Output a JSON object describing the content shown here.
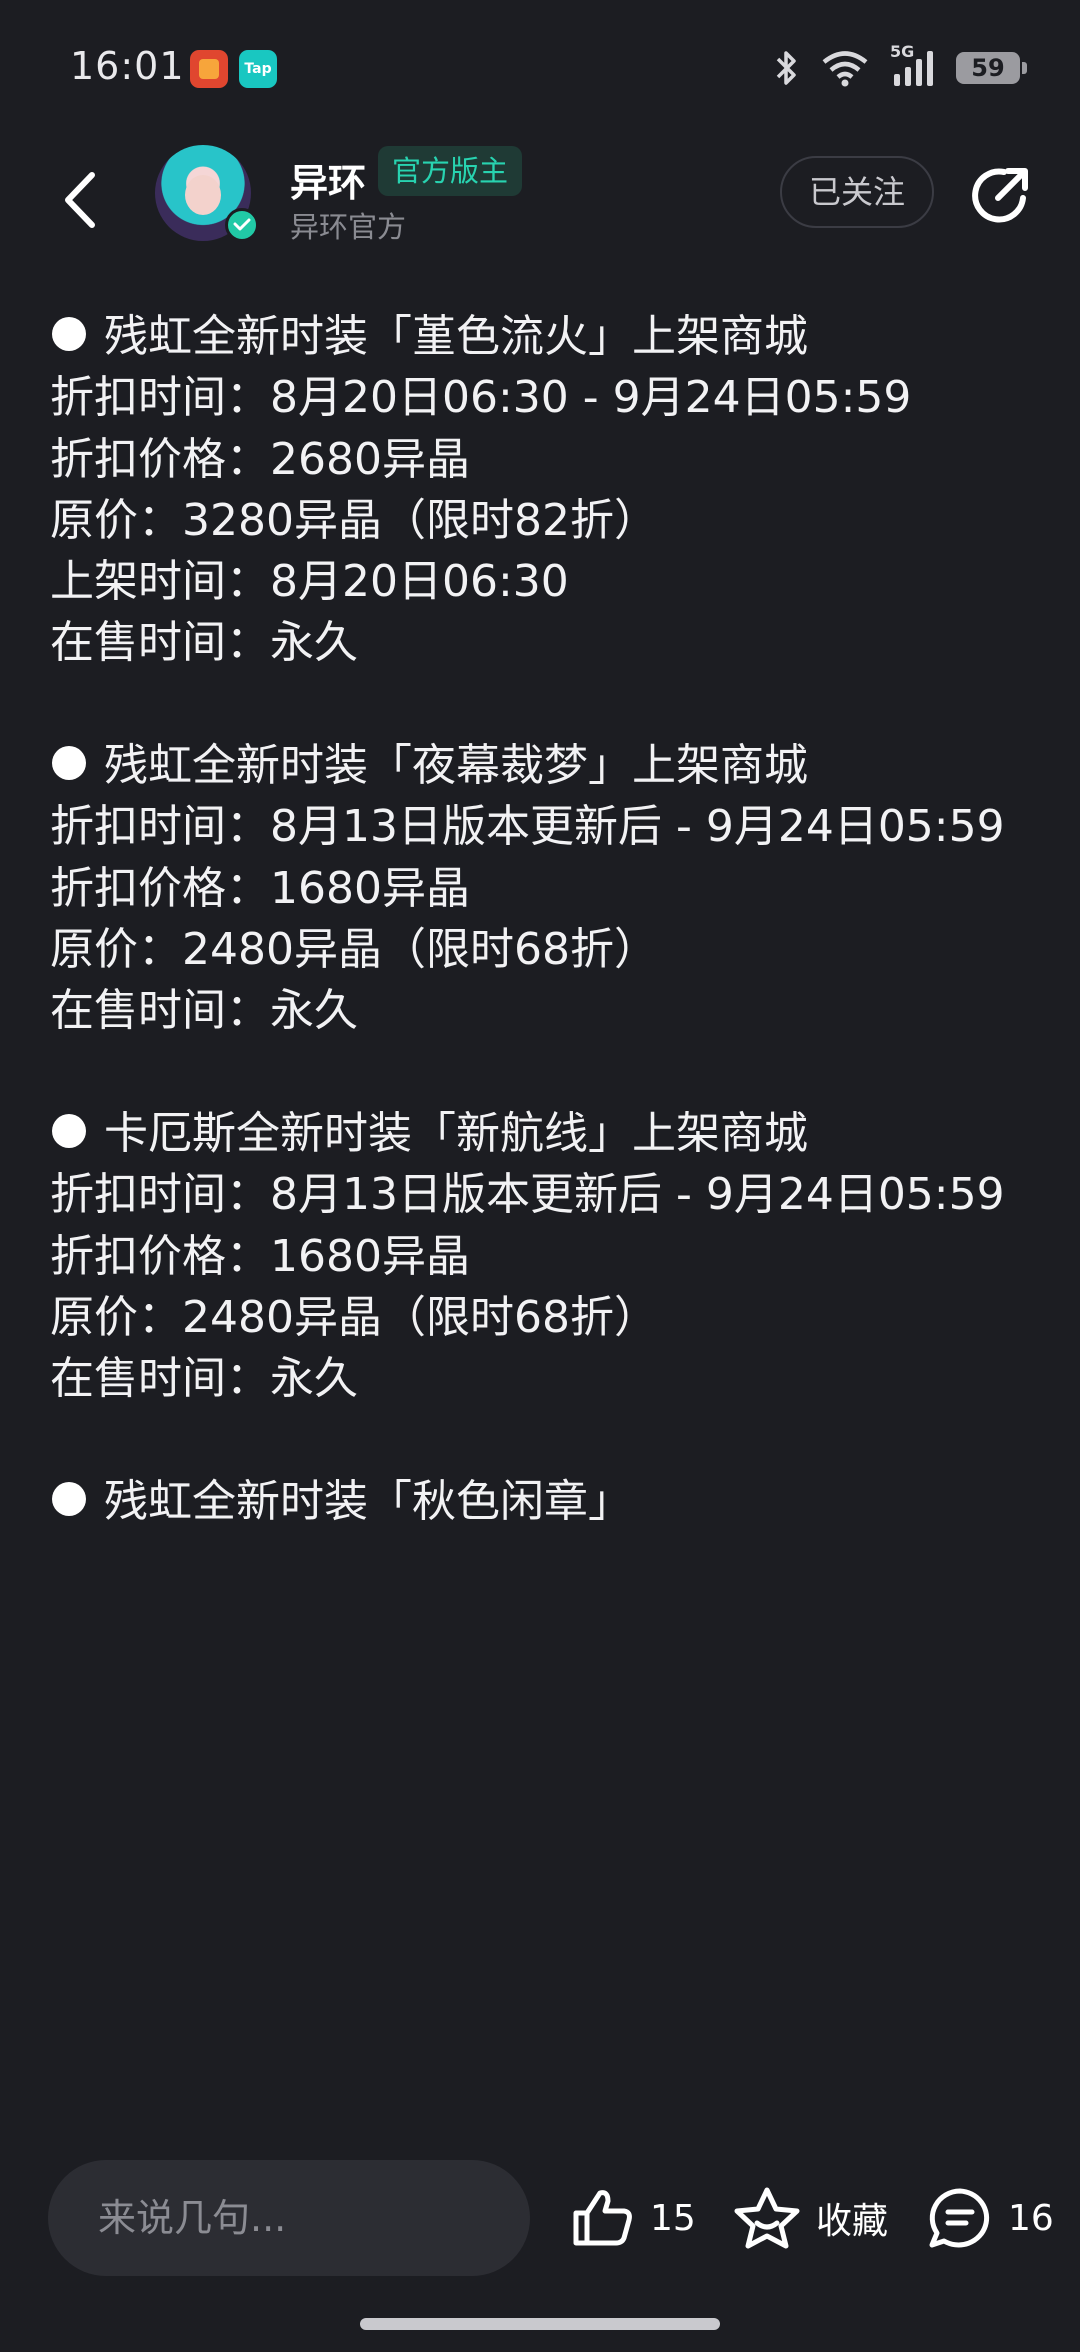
{
  "status_bar": {
    "time": "16:01",
    "apps": [
      "shop-app-icon",
      "taptap-icon"
    ],
    "taptap_label": "Tap",
    "icons": [
      "bluetooth-icon",
      "wifi-icon",
      "5g-signal-icon"
    ],
    "network": "5G",
    "battery": "59"
  },
  "header": {
    "author_name": "异环",
    "role_badge": "官方版主",
    "subtitle": "异环官方",
    "follow_label": "已关注"
  },
  "post": {
    "sections": [
      {
        "title": "残虹全新时装「堇色流火」上架商城",
        "lines": [
          "折扣时间：8月20日06:30 - 9月24日05:59",
          "折扣价格：2680异晶",
          "原价：3280异晶（限时82折）",
          "上架时间：8月20日06:30",
          "在售时间：永久"
        ]
      },
      {
        "title": "残虹全新时装「夜幕裁梦」上架商城",
        "lines": [
          "折扣时间：8月13日版本更新后 - 9月24日05:59",
          "折扣价格：1680异晶",
          "原价：2480异晶（限时68折）",
          "在售时间：永久"
        ]
      },
      {
        "title": "卡厄斯全新时装「新航线」上架商城",
        "lines": [
          "折扣时间：8月13日版本更新后 - 9月24日05:59",
          "折扣价格：1680异晶",
          "原价：2480异晶（限时68折）",
          "在售时间：永久"
        ]
      },
      {
        "title": "残虹全新时装「秋色闲章」",
        "lines": []
      }
    ]
  },
  "bottom_bar": {
    "comment_placeholder": "来说几句...",
    "like_count": "15",
    "favorite_label": "收藏",
    "comment_count": "16"
  },
  "colors": {
    "background": "#1c1d22",
    "accent_teal": "#28d3b0",
    "badge_bg": "#1f3a35",
    "input_bg": "#2c2d33"
  }
}
